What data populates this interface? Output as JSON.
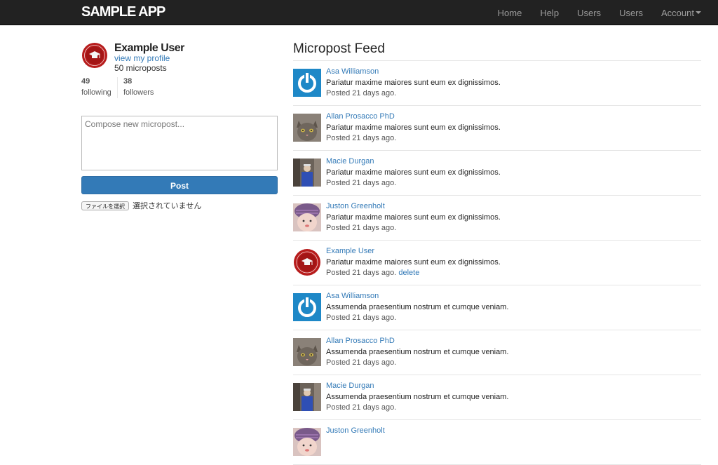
{
  "navbar": {
    "logo": "SAMPLE APP",
    "links": [
      "Home",
      "Help",
      "Users",
      "Users"
    ],
    "account": "Account"
  },
  "sidebar": {
    "user_name": "Example User",
    "profile_link": "view my profile",
    "micropost_count": "50 microposts",
    "following_count": "49",
    "following_label": "following",
    "followers_count": "38",
    "followers_label": "followers",
    "compose_placeholder": "Compose new micropost...",
    "post_button": "Post",
    "file_button": "ファイルを選択",
    "file_status": "選択されていません"
  },
  "feed": {
    "title": "Micropost Feed",
    "items": [
      {
        "user": "Asa Williamson",
        "content": "Pariatur maxime maiores sunt eum ex dignissimos.",
        "time": "Posted 21 days ago.",
        "avatar": "power-icon",
        "delete": ""
      },
      {
        "user": "Allan Prosacco PhD",
        "content": "Pariatur maxime maiores sunt eum ex dignissimos.",
        "time": "Posted 21 days ago.",
        "avatar": "cat-photo",
        "delete": ""
      },
      {
        "user": "Macie Durgan",
        "content": "Pariatur maxime maiores sunt eum ex dignissimos.",
        "time": "Posted 21 days ago.",
        "avatar": "person-photo",
        "delete": ""
      },
      {
        "user": "Juston Greenholt",
        "content": "Pariatur maxime maiores sunt eum ex dignissimos.",
        "time": "Posted 21 days ago.",
        "avatar": "baby-photo",
        "delete": ""
      },
      {
        "user": "Example User",
        "content": "Pariatur maxime maiores sunt eum ex dignissimos.",
        "time": "Posted 21 days ago.",
        "avatar": "rails-badge",
        "delete": "delete"
      },
      {
        "user": "Asa Williamson",
        "content": "Assumenda praesentium nostrum et cumque veniam.",
        "time": "Posted 21 days ago.",
        "avatar": "power-icon",
        "delete": ""
      },
      {
        "user": "Allan Prosacco PhD",
        "content": "Assumenda praesentium nostrum et cumque veniam.",
        "time": "Posted 21 days ago.",
        "avatar": "cat-photo",
        "delete": ""
      },
      {
        "user": "Macie Durgan",
        "content": "Assumenda praesentium nostrum et cumque veniam.",
        "time": "Posted 21 days ago.",
        "avatar": "person-photo",
        "delete": ""
      },
      {
        "user": "Juston Greenholt",
        "content": "",
        "time": "",
        "avatar": "baby-photo",
        "delete": ""
      }
    ]
  },
  "colors": {
    "navbar_bg": "#222222",
    "link": "#337ab7",
    "button": "#337ab7"
  }
}
